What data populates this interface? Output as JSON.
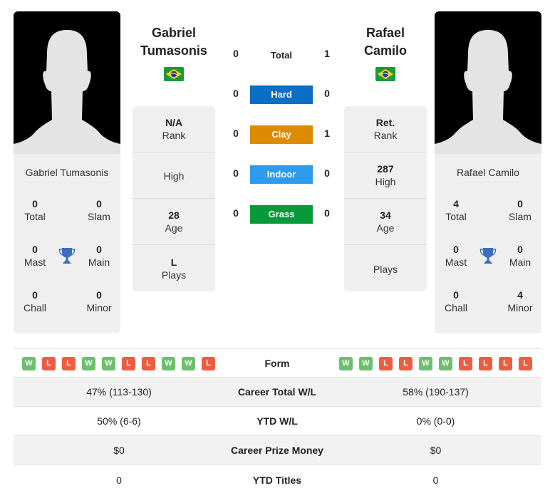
{
  "players": [
    {
      "name": "Gabriel Tumasonis",
      "name_line1": "Gabriel",
      "name_line2": "Tumasonis",
      "country": "Brazil",
      "titles": {
        "total": "0",
        "slam": "0",
        "mast": "0",
        "main": "0",
        "chall": "0",
        "minor": "0"
      },
      "info": {
        "rank": "N/A",
        "high": "",
        "age": "28",
        "plays": "L"
      },
      "form": [
        "W",
        "L",
        "L",
        "W",
        "W",
        "L",
        "L",
        "W",
        "W",
        "L"
      ]
    },
    {
      "name": "Rafael Camilo",
      "name_line1": "Rafael",
      "name_line2": "Camilo",
      "country": "Brazil",
      "titles": {
        "total": "4",
        "slam": "0",
        "mast": "0",
        "main": "0",
        "chall": "0",
        "minor": "4"
      },
      "info": {
        "rank": "Ret.",
        "high": "287",
        "age": "34",
        "plays": ""
      },
      "form": [
        "W",
        "W",
        "L",
        "L",
        "W",
        "W",
        "L",
        "L",
        "L",
        "L"
      ]
    }
  ],
  "labels": {
    "total": "Total",
    "slam": "Slam",
    "mast": "Mast",
    "main": "Main",
    "chall": "Chall",
    "minor": "Minor",
    "rank": "Rank",
    "high": "High",
    "age": "Age",
    "plays": "Plays",
    "form": "Form"
  },
  "h2h": {
    "total": {
      "label": "Total",
      "p1": "0",
      "p2": "1"
    },
    "surfaces": [
      {
        "label": "Hard",
        "p1": "0",
        "p2": "0",
        "color": "#0a6ec4"
      },
      {
        "label": "Clay",
        "p1": "0",
        "p2": "1",
        "color": "#dd8b00"
      },
      {
        "label": "Indoor",
        "p1": "0",
        "p2": "0",
        "color": "#2d9bef"
      },
      {
        "label": "Grass",
        "p1": "0",
        "p2": "0",
        "color": "#079a3a"
      }
    ]
  },
  "stats": [
    {
      "label": "Career Total W/L",
      "p1": "47% (113-130)",
      "p2": "58% (190-137)"
    },
    {
      "label": "YTD W/L",
      "p1": "50% (6-6)",
      "p2": "0% (0-0)"
    },
    {
      "label": "Career Prize Money",
      "p1": "$0",
      "p2": "$0"
    },
    {
      "label": "YTD Titles",
      "p1": "0",
      "p2": "0"
    }
  ],
  "colors": {
    "win": "#6cbf6c",
    "loss": "#ee5c42",
    "trophy": "#3a6fbf"
  }
}
